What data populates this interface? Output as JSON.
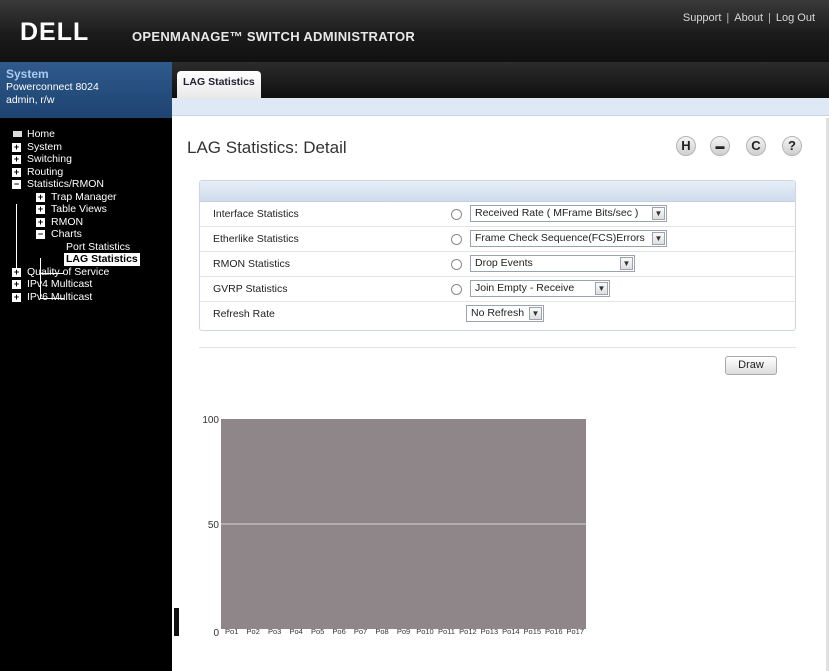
{
  "header": {
    "logo": "DELL",
    "app_title": "OPENMANAGE™ SWITCH ADMINISTRATOR",
    "links": [
      "Support",
      "About",
      "Log Out"
    ]
  },
  "system_box": {
    "title": "System",
    "model": "Powerconnect 8024",
    "user": "admin, r/w"
  },
  "nav": {
    "home": "Home",
    "system": "System",
    "switching": "Switching",
    "routing": "Routing",
    "stats_rmon": "Statistics/RMON",
    "trap_manager": "Trap Manager",
    "table_views": "Table Views",
    "rmon": "RMON",
    "charts": "Charts",
    "port_statistics": "Port Statistics",
    "lag_statistics": "LAG Statistics",
    "qos": "Quality of Service",
    "ipv4_multicast": "IPv4 Multicast",
    "ipv6_multicast": "IPv6 Multicast"
  },
  "tab": {
    "label": "LAG Statistics"
  },
  "page": {
    "title": "LAG Statistics: Detail"
  },
  "toolbar": {
    "save": "H",
    "print": "▬",
    "refresh": "C",
    "help": "?"
  },
  "form": {
    "interface": {
      "label": "Interface Statistics",
      "value": "Received Rate ( MFrame Bits/sec )"
    },
    "etherlike": {
      "label": "Etherlike Statistics",
      "value": "Frame Check Sequence(FCS)Errors"
    },
    "rmon": {
      "label": "RMON Statistics",
      "value": "Drop Events"
    },
    "gvrp": {
      "label": "GVRP Statistics",
      "value": "Join Empty - Receive"
    },
    "refresh": {
      "label": "Refresh Rate",
      "value": "No Refresh"
    }
  },
  "draw_button": "Draw",
  "colors": {
    "bar": "#8e8689",
    "nav_bg": "#000000",
    "header_bg": "#1b1b1b",
    "sys_box": "#1d4370"
  },
  "chart_data": {
    "type": "bar",
    "categories": [
      "Po1",
      "Po2",
      "Po3",
      "Po4",
      "Po5",
      "Po6",
      "Po7",
      "Po8",
      "Po9",
      "Po10",
      "Po11",
      "Po12",
      "Po13",
      "Po14",
      "Po15",
      "Po16",
      "Po17"
    ],
    "values": [],
    "ylim": [
      0,
      100
    ],
    "yticks": [
      0,
      50,
      100
    ],
    "plot_area_fill": "#8e8689",
    "gridline_at": 50
  }
}
